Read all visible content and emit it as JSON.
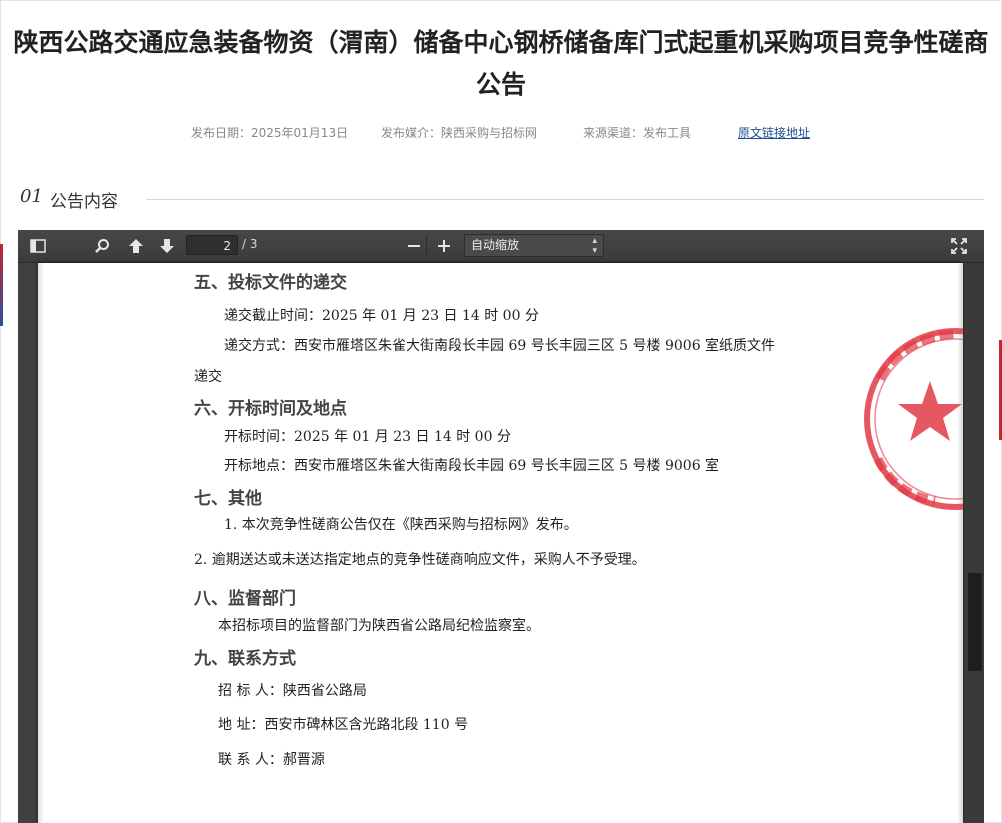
{
  "article": {
    "title_line1": "陕西公路交通应急装备物资（渭南）储备中心钢桥储备库门式起重机采购项目竞争性磋商",
    "title_line2": "公告",
    "meta": {
      "publish_date": "发布日期：2025年01月13日",
      "publish_media": "发布媒介：陕西采购与招标网",
      "source_channel": "来源渠道：发布工具",
      "original_link": "原文链接地址"
    },
    "section": {
      "number": "01",
      "label": "公告内容"
    }
  },
  "viewer": {
    "page_current": "2",
    "page_total": "/ 3",
    "zoom": "自动缩放",
    "icons": {
      "sidebar": "sidebar-toggle-icon",
      "search": "search-icon",
      "prev": "arrow-up-icon",
      "next": "arrow-down-icon",
      "zoom_out": "minus-icon",
      "zoom_in": "plus-icon",
      "fullscreen": "fullscreen-icon"
    }
  },
  "document": {
    "s5_heading": "五、投标文件的递交",
    "s5_line1": "递交截止时间：2025 年 01 月 23 日  14 时 00 分",
    "s5_line2": "递交方式：西安市雁塔区朱雀大街南段长丰园 69 号长丰园三区 5 号楼 9006 室纸质文件",
    "s5_line3": "递交",
    "s6_heading": "六、开标时间及地点",
    "s6_line1": "开标时间：2025 年 01 月 23 日  14 时 00 分",
    "s6_line2": "开标地点：西安市雁塔区朱雀大街南段长丰园 69 号长丰园三区 5 号楼 9006 室",
    "s7_heading": "七、其他",
    "s7_line1": "1. 本次竞争性磋商公告仅在《陕西采购与招标网》发布。",
    "s7_line2": "2. 逾期送达或未送达指定地点的竞争性磋商响应文件，采购人不予受理。",
    "s8_heading": "八、监督部门",
    "s8_line1": "本招标项目的监督部门为陕西省公路局纪检监察室。",
    "s9_heading": "九、联系方式",
    "s9_line1": "招  标  人：陕西省公路局",
    "s9_line2": "地      址：西安市碑林区含光路北段 110 号",
    "s9_line3": "联  系  人：郝晋源"
  },
  "colors": {
    "accent_link": "#1f4e8c",
    "stamp_red": "#e23b45",
    "toolbar": "#404040"
  }
}
